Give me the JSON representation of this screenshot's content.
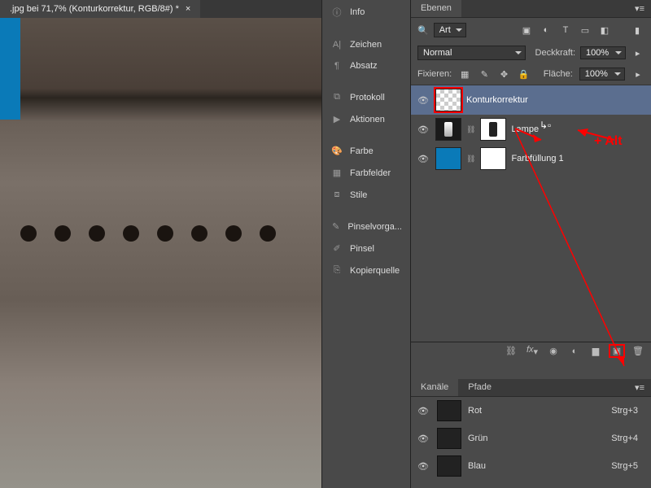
{
  "document": {
    "title": ".jpg bei 71,7% (Konturkorrektur, RGB/8#) *"
  },
  "sidepanel": {
    "items": [
      {
        "icon": "ⓘ",
        "label": "Info"
      },
      {
        "spacer": true
      },
      {
        "icon": "A|",
        "label": "Zeichen"
      },
      {
        "icon": "¶",
        "label": "Absatz"
      },
      {
        "spacer": true
      },
      {
        "icon": "⧉",
        "label": "Protokoll"
      },
      {
        "icon": "▶",
        "label": "Aktionen"
      },
      {
        "spacer": true
      },
      {
        "icon": "🎨",
        "label": "Farbe"
      },
      {
        "icon": "▦",
        "label": "Farbfelder"
      },
      {
        "icon": "⧈",
        "label": "Stile"
      },
      {
        "spacer": true
      },
      {
        "icon": "✎",
        "label": "Pinselvorga..."
      },
      {
        "icon": "✐",
        "label": "Pinsel"
      },
      {
        "icon": "⎘",
        "label": "Kopierquelle"
      }
    ]
  },
  "layers": {
    "tab": "Ebenen",
    "filter_label": "Art",
    "blend": "Normal",
    "opacity_label": "Deckkraft:",
    "opacity": "100%",
    "fill_label": "Fläche:",
    "fill": "100%",
    "lock_label": "Fixieren:",
    "rows": [
      {
        "name": "Konturkorrektur",
        "selected": true
      },
      {
        "name": "Lampe"
      },
      {
        "name": "Farbfüllung 1"
      }
    ]
  },
  "channels": {
    "tabs": [
      "Kanäle",
      "Pfade"
    ],
    "rows": [
      {
        "name": "Rot",
        "shortcut": "Strg+3"
      },
      {
        "name": "Grün",
        "shortcut": "Strg+4"
      },
      {
        "name": "Blau",
        "shortcut": "Strg+5"
      }
    ]
  },
  "annotation": {
    "text": "+ Alt"
  }
}
